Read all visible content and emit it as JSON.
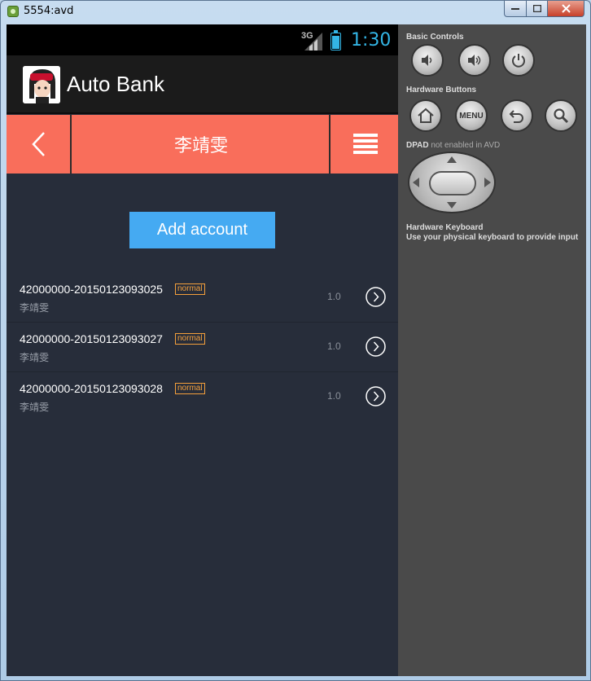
{
  "window": {
    "title": "5554:avd"
  },
  "status_bar": {
    "network": "3G",
    "time": "1:30"
  },
  "action_bar": {
    "app_name": "Auto Bank"
  },
  "nav_bar": {
    "title": "李靖雯"
  },
  "content": {
    "add_button_label": "Add account",
    "accounts": [
      {
        "number": "42000000-20150123093025",
        "status": "normal",
        "owner": "李靖雯",
        "amount": "1.0"
      },
      {
        "number": "42000000-20150123093027",
        "status": "normal",
        "owner": "李靖雯",
        "amount": "1.0"
      },
      {
        "number": "42000000-20150123093028",
        "status": "normal",
        "owner": "李靖雯",
        "amount": "1.0"
      }
    ]
  },
  "emulator_controls": {
    "basic_controls_label": "Basic Controls",
    "hardware_buttons_label": "Hardware Buttons",
    "menu_label": "MENU",
    "dpad_label": "DPAD",
    "dpad_note": "not enabled in AVD",
    "keyboard_label": "Hardware Keyboard",
    "keyboard_note": "Use your physical keyboard to provide input"
  },
  "colors": {
    "accent": "#f96e5b",
    "button": "#45aaf2",
    "badge": "#f5a03b",
    "clock": "#33b5e5"
  }
}
